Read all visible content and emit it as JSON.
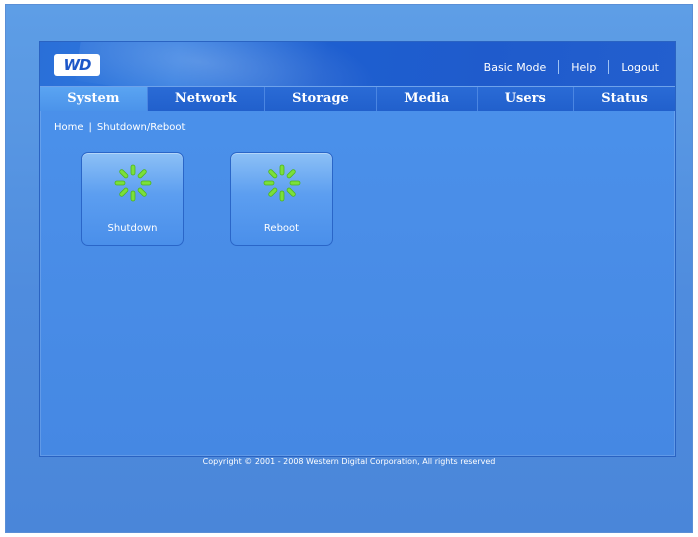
{
  "brand": {
    "logo_text": "WD"
  },
  "top_links": {
    "basic_mode": "Basic Mode",
    "help": "Help",
    "logout": "Logout"
  },
  "tabs": [
    {
      "label": "System",
      "active": true
    },
    {
      "label": "Network",
      "active": false
    },
    {
      "label": "Storage",
      "active": false
    },
    {
      "label": "Media",
      "active": false
    },
    {
      "label": "Users",
      "active": false
    },
    {
      "label": "Status",
      "active": false
    }
  ],
  "breadcrumb": {
    "home": "Home",
    "separator": "|",
    "current": "Shutdown/Reboot"
  },
  "actions": [
    {
      "label": "Shutdown",
      "icon": "spinner-icon"
    },
    {
      "label": "Reboot",
      "icon": "spinner-icon"
    }
  ],
  "footer": {
    "copyright": "Copyright © 2001 - 2008 Western Digital Corporation, All rights reserved"
  },
  "colors": {
    "background": "#4f8cde",
    "panel": "#4a8ee8",
    "header": "#1f5bcc",
    "active_tab": "#5aa4f2",
    "spinner": "#7be03a"
  }
}
